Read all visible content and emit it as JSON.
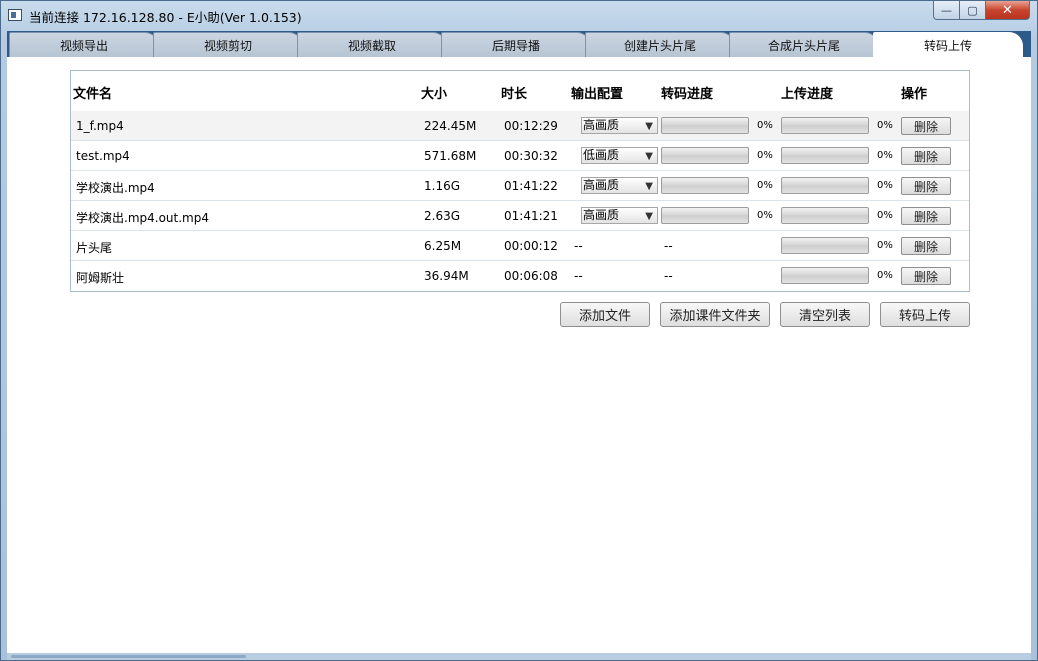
{
  "window": {
    "title": "当前连接 172.16.128.80  -  E小助(Ver 1.0.153)",
    "controls": {
      "minimize": "—",
      "maximize": "▢",
      "close": "✕"
    }
  },
  "tabs": [
    {
      "label": "视频导出"
    },
    {
      "label": "视频剪切"
    },
    {
      "label": "视频截取"
    },
    {
      "label": "后期导播"
    },
    {
      "label": "创建片头片尾"
    },
    {
      "label": "合成片头片尾"
    },
    {
      "label": "转码上传",
      "active": true
    }
  ],
  "table": {
    "headers": {
      "name": "文件名",
      "size": "大小",
      "duration": "时长",
      "output": "输出配置",
      "transcode": "转码进度",
      "upload": "上传进度",
      "action": "操作"
    },
    "rows": [
      {
        "name": "1_f.mp4",
        "size": "224.45M",
        "duration": "00:12:29",
        "output": "高画质",
        "transcode_pct": "0%",
        "transcode_progress": 0,
        "upload_pct": "0%",
        "upload_progress": 0,
        "delete_label": "删除"
      },
      {
        "name": "test.mp4",
        "size": "571.68M",
        "duration": "00:30:32",
        "output": "低画质",
        "transcode_pct": "0%",
        "transcode_progress": 0,
        "upload_pct": "0%",
        "upload_progress": 0,
        "delete_label": "删除"
      },
      {
        "name": "学校演出.mp4",
        "size": "1.16G",
        "duration": "01:41:22",
        "output": "高画质",
        "transcode_pct": "0%",
        "transcode_progress": 0,
        "upload_pct": "0%",
        "upload_progress": 0,
        "delete_label": "删除"
      },
      {
        "name": "学校演出.mp4.out.mp4",
        "size": "2.63G",
        "duration": "01:41:21",
        "output": "高画质",
        "transcode_pct": "0%",
        "transcode_progress": 0,
        "upload_pct": "0%",
        "upload_progress": 0,
        "delete_label": "删除"
      },
      {
        "name": "片头尾",
        "size": "6.25M",
        "duration": "00:00:12",
        "output_text": "--",
        "transcode_text": "--",
        "upload_pct": "0%",
        "upload_progress": 0,
        "delete_label": "删除"
      },
      {
        "name": "阿姆斯壮",
        "size": "36.94M",
        "duration": "00:06:08",
        "output_text": "--",
        "transcode_text": "--",
        "upload_pct": "0%",
        "upload_progress": 0,
        "delete_label": "删除"
      }
    ]
  },
  "actions": {
    "add_file": "添加文件",
    "add_folder": "添加课件文件夹",
    "clear_list": "清空列表",
    "transcode_upload": "转码上传"
  },
  "colors": {
    "tabbar_bg": "#2d5a88",
    "progress_fill": "#3cb371"
  }
}
